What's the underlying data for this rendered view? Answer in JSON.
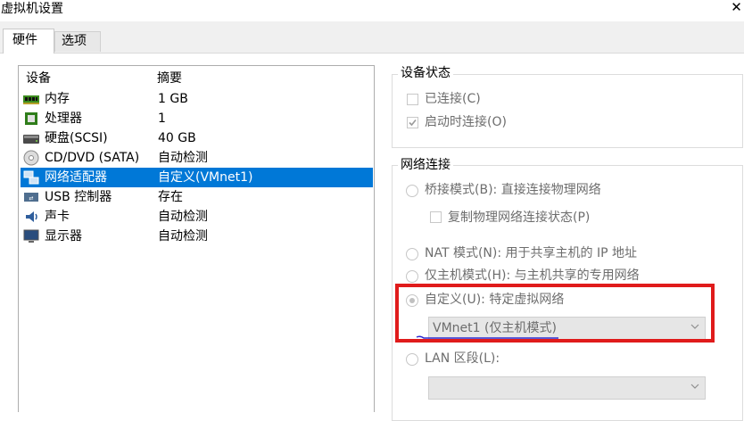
{
  "window": {
    "title": "虚拟机设置"
  },
  "tabs": [
    {
      "label": "硬件",
      "active": true
    },
    {
      "label": "选项",
      "active": false
    }
  ],
  "device_list": {
    "headers": {
      "device": "设备",
      "summary": "摘要"
    },
    "rows": [
      {
        "name": "内存",
        "summary": "1 GB",
        "icon": "memory-icon"
      },
      {
        "name": "处理器",
        "summary": "1",
        "icon": "processor-icon"
      },
      {
        "name": "硬盘(SCSI)",
        "summary": "40 GB",
        "icon": "hard-disk-icon"
      },
      {
        "name": "CD/DVD (SATA)",
        "summary": "自动检测",
        "icon": "cd-dvd-icon"
      },
      {
        "name": "网络适配器",
        "summary": "自定义(VMnet1)",
        "icon": "network-adapter-icon",
        "selected": true
      },
      {
        "name": "USB 控制器",
        "summary": "存在",
        "icon": "usb-icon"
      },
      {
        "name": "声卡",
        "summary": "自动检测",
        "icon": "sound-card-icon"
      },
      {
        "name": "显示器",
        "summary": "自动检测",
        "icon": "display-icon"
      }
    ]
  },
  "device_status": {
    "title": "设备状态",
    "connected": {
      "label": "已连接(C)",
      "checked": false
    },
    "connect_at_power_on": {
      "label": "启动时连接(O)",
      "checked": true
    }
  },
  "network_connection": {
    "title": "网络连接",
    "bridged": {
      "label": "桥接模式(B): 直接连接物理网络",
      "selected": false
    },
    "replicate_state": {
      "label": "复制物理网络连接状态(P)",
      "checked": false
    },
    "nat": {
      "label": "NAT 模式(N): 用于共享主机的 IP 地址",
      "selected": false
    },
    "host_only": {
      "label": "仅主机模式(H): 与主机共享的专用网络",
      "selected": false
    },
    "custom": {
      "label": "自定义(U): 特定虚拟网络",
      "selected": true
    },
    "custom_select_value": "VMnet1 (仅主机模式)",
    "lan_segment": {
      "label": "LAN 区段(L):",
      "selected": false
    },
    "lan_select_value": ""
  },
  "colors": {
    "selection": "#0078d7",
    "annotation_box": "#e01b1b",
    "annotation_underline": "#2a2ad0"
  }
}
